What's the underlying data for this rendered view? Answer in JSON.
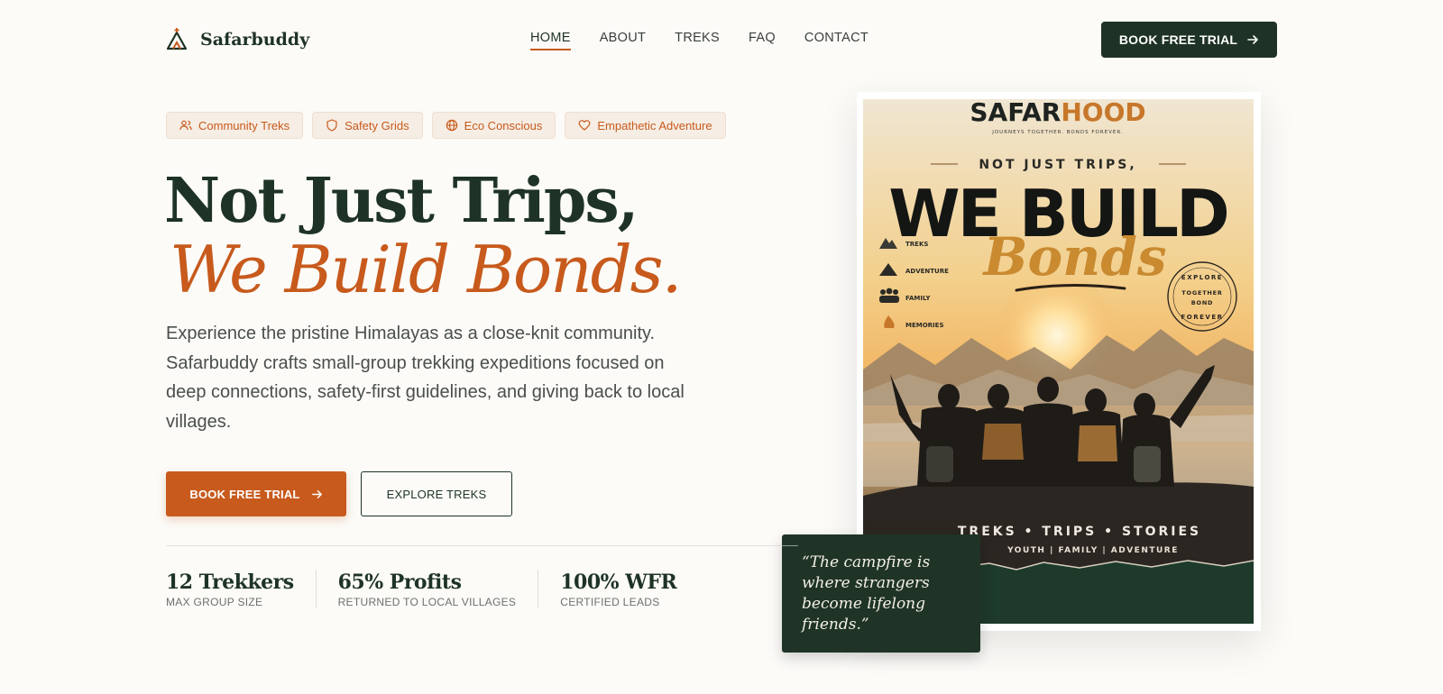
{
  "brand": {
    "name": "Safarbuddy",
    "accent": "#c75a1c",
    "dark": "#1e3325",
    "background": "#fcfbf8"
  },
  "nav": {
    "items": [
      {
        "label": "HOME",
        "active": true
      },
      {
        "label": "ABOUT",
        "active": false
      },
      {
        "label": "TREKS",
        "active": false
      },
      {
        "label": "FAQ",
        "active": false
      },
      {
        "label": "CONTACT",
        "active": false
      }
    ],
    "cta": "BOOK FREE TRIAL",
    "cta_icon": "arrow-right-icon"
  },
  "tags": [
    {
      "label": "Community Treks",
      "icon": "users-icon"
    },
    {
      "label": "Safety Grids",
      "icon": "shield-icon"
    },
    {
      "label": "Eco Conscious",
      "icon": "globe-icon"
    },
    {
      "label": "Empathetic Adventure",
      "icon": "heart-icon"
    }
  ],
  "hero": {
    "title_line1": "Not Just Trips,",
    "title_line2": "We Build Bonds.",
    "description": "Experience the pristine Himalayas as a close-knit community. Safarbuddy crafts small-group trekking expeditions focused on deep connections, safety-first guidelines, and giving back to local villages.",
    "primary_cta": "BOOK FREE TRIAL",
    "secondary_cta": "EXPLORE TREKS"
  },
  "stats": [
    {
      "value": "12 Trekkers",
      "label": "MAX GROUP SIZE"
    },
    {
      "value": "65% Profits",
      "label": "RETURNED TO LOCAL VILLAGES"
    },
    {
      "value": "100% WFR",
      "label": "CERTIFIED LEADS"
    }
  ],
  "poster": {
    "brand_a": "SAFAR",
    "brand_b": "HOOD",
    "tagline": "JOURNEYS TOGETHER. BONDS FOREVER.",
    "kicker": "NOT JUST TRIPS,",
    "headline": "WE BUILD",
    "script": "Bonds",
    "features": [
      "TREKS",
      "ADVENTURE",
      "FAMILY",
      "MEMORIES"
    ],
    "stamp_top": "EXPLORE",
    "stamp_mid1": "TOGETHER",
    "stamp_mid2": "BOND",
    "stamp_bottom": "FOREVER",
    "footer_line1": "TREKS • TRIPS • STORIES",
    "footer_line2": "YOUTH | FAMILY | ADVENTURE"
  },
  "quote": "“The campfire is where strangers become lifelong friends.”"
}
